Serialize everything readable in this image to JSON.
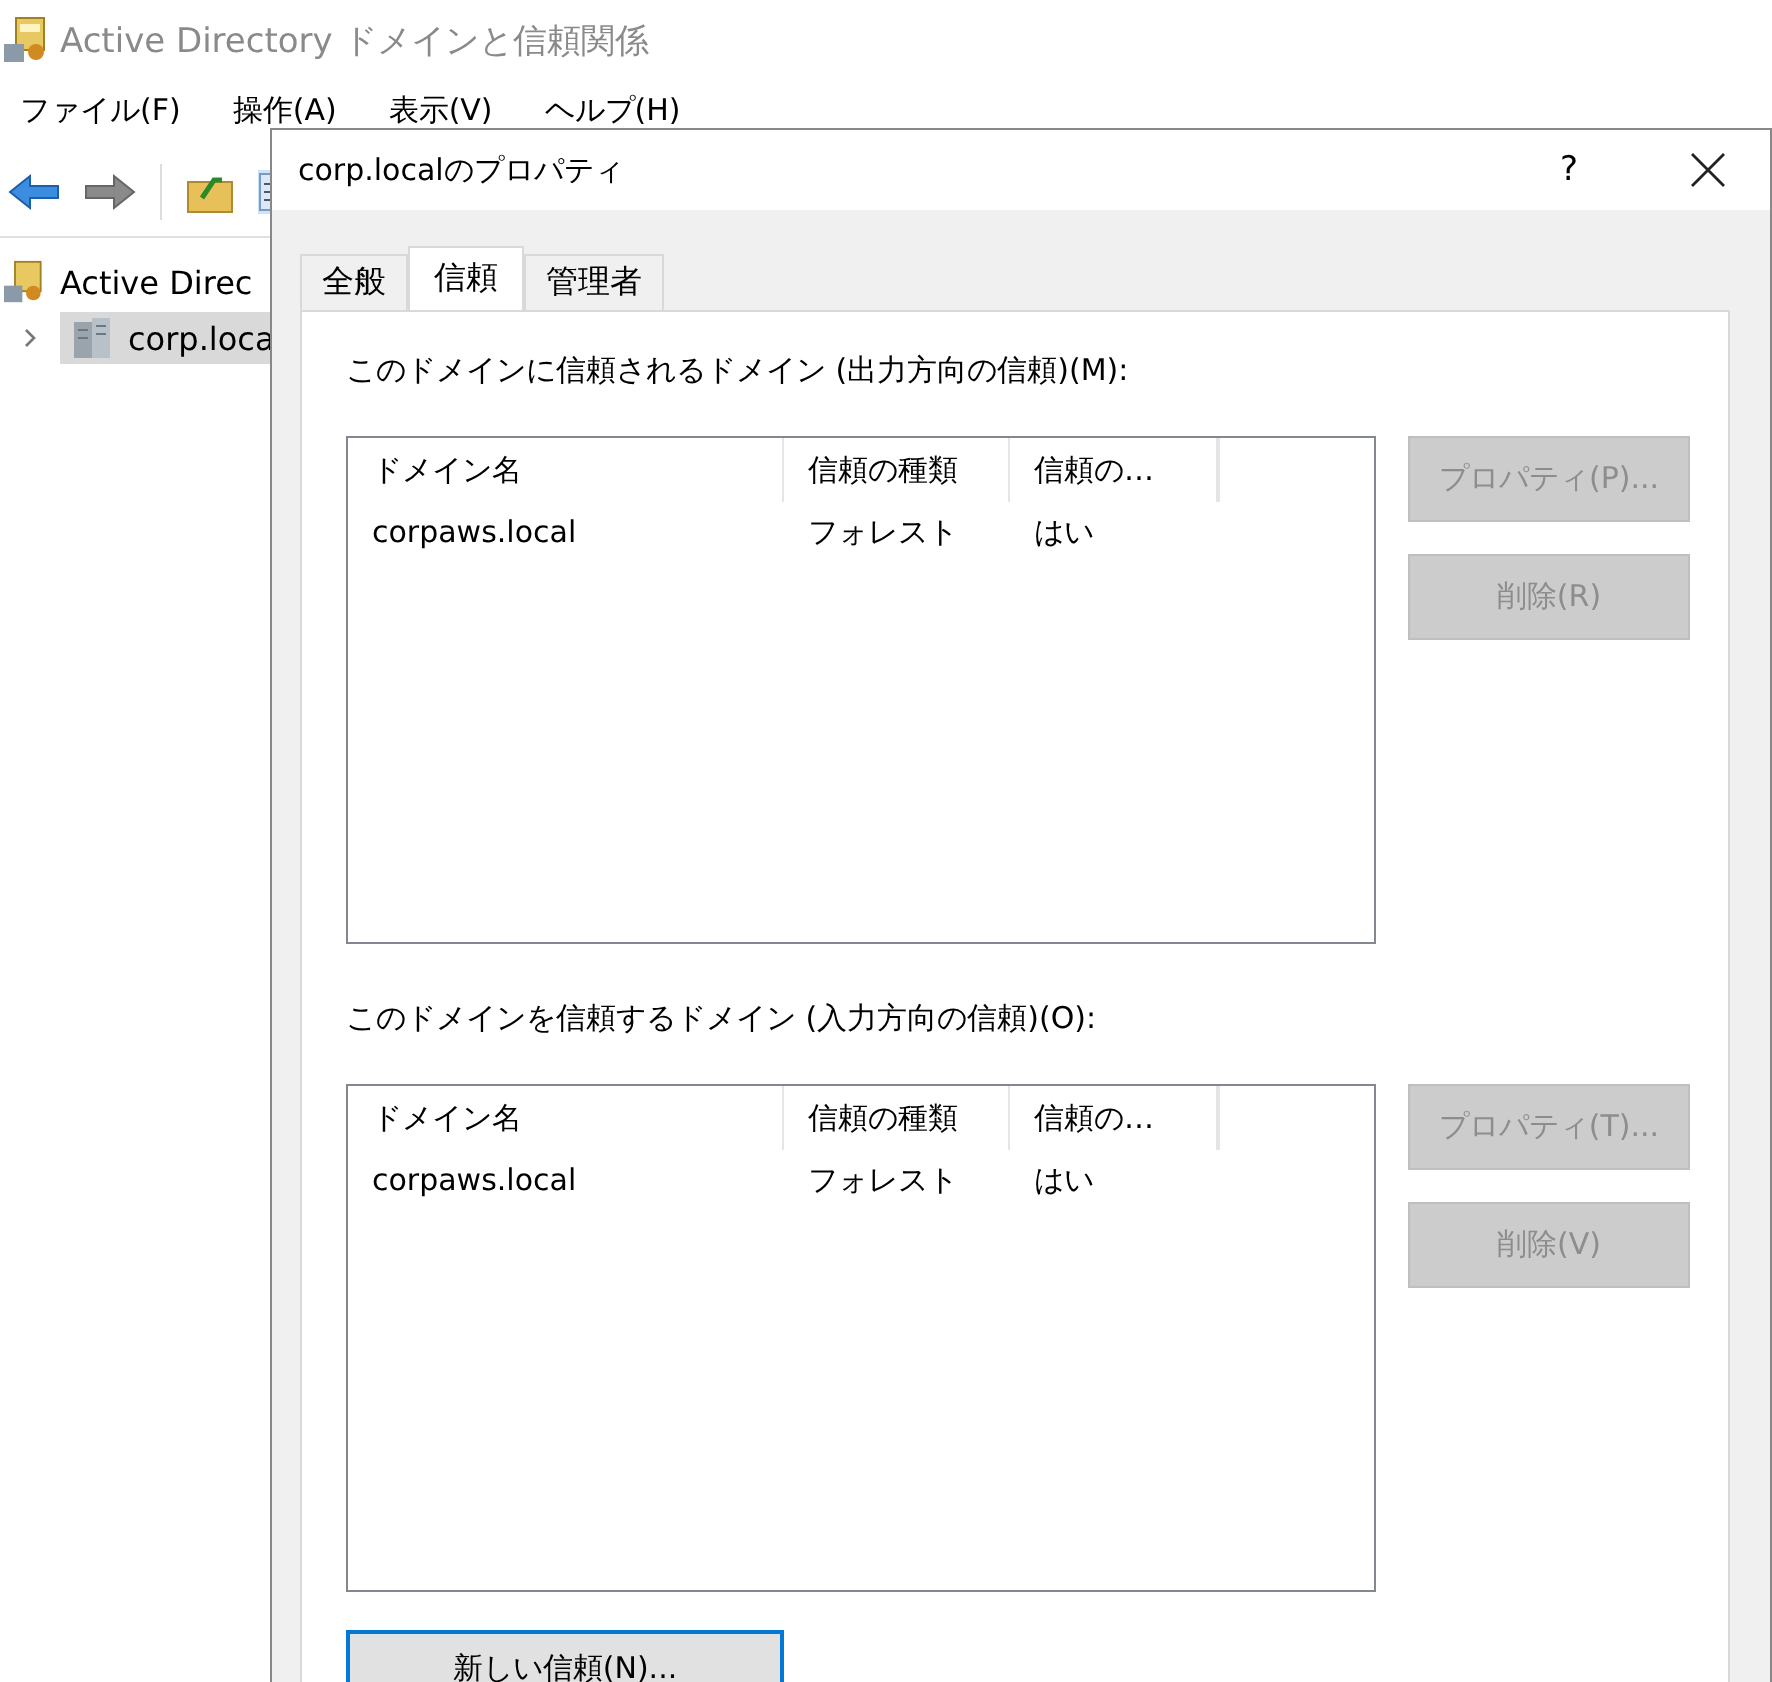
{
  "main_window": {
    "title": "Active Directory ドメインと信頼関係",
    "menu": [
      "ファイル(F)",
      "操作(A)",
      "表示(V)",
      "ヘルプ(H)"
    ],
    "tree": [
      {
        "label": "Active Direc",
        "selected": false,
        "children": [
          {
            "label": "corp.loca",
            "selected": true,
            "expanded": false
          }
        ]
      }
    ]
  },
  "dialog": {
    "title": "corp.localのプロパティ",
    "help": "?",
    "tabs": [
      {
        "label": "全般",
        "selected": false
      },
      {
        "label": "信頼",
        "selected": true
      },
      {
        "label": "管理者",
        "selected": false
      }
    ],
    "sections": [
      {
        "label": "このドメインに信頼されるドメイン (出力方向の信頼)(M):",
        "columns": [
          "ドメイン名",
          "信頼の種類",
          "信頼の…"
        ],
        "rows": [
          [
            "corpaws.local",
            "フォレスト",
            "はい"
          ]
        ],
        "buttons": [
          {
            "label": "プロパティ(P)...",
            "disabled": true
          },
          {
            "label": "削除(R)",
            "disabled": true
          }
        ]
      },
      {
        "label": "このドメインを信頼するドメイン (入力方向の信頼)(O):",
        "columns": [
          "ドメイン名",
          "信頼の種類",
          "信頼の…"
        ],
        "rows": [
          [
            "corpaws.local",
            "フォレスト",
            "はい"
          ]
        ],
        "buttons": [
          {
            "label": "プロパティ(T)...",
            "disabled": true
          },
          {
            "label": "削除(V)",
            "disabled": true
          }
        ]
      }
    ],
    "new_trust_button": {
      "label": "新しい信頼(N)...",
      "disabled": false
    }
  }
}
